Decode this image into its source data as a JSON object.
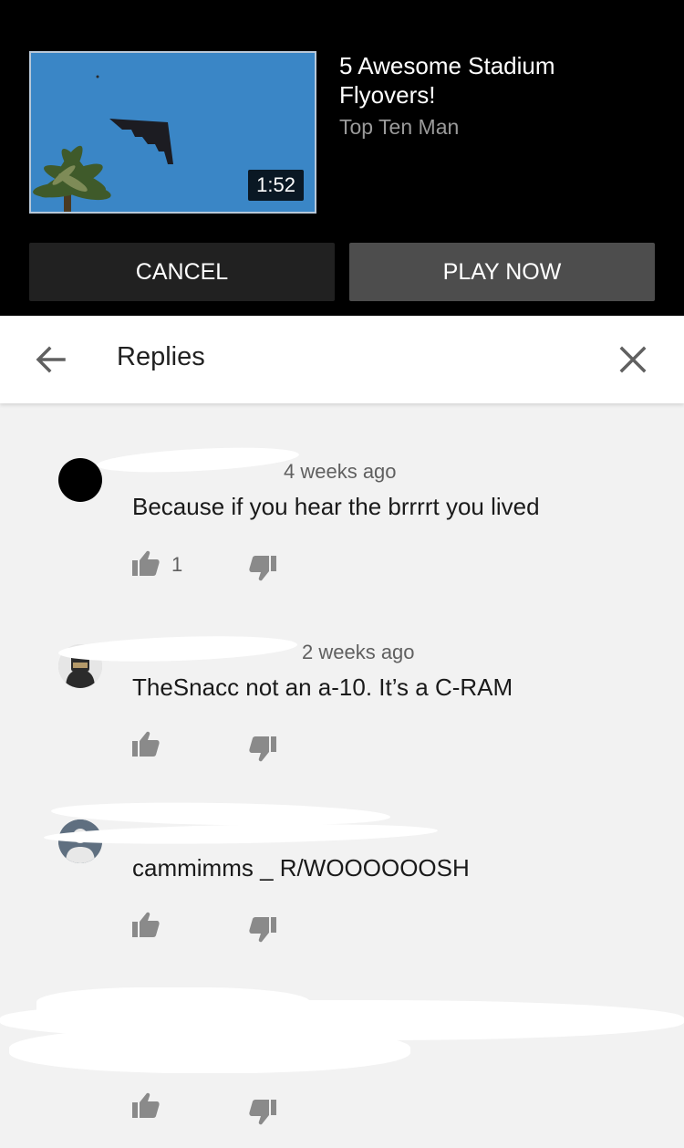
{
  "up_next": {
    "title": "5 Awesome Stadium Flyovers!",
    "channel": "Top Ten Man",
    "duration": "1:52",
    "cancel_label": "CANCEL",
    "play_label": "PLAY NOW"
  },
  "replies": {
    "title": "Replies"
  },
  "comments": [
    {
      "meta": "4 weeks ago",
      "text": "Because if you hear the brrrrt you lived",
      "likes": "1"
    },
    {
      "meta": "2 weeks ago",
      "text": "TheSnacc not an a-10. It’s a C-RAM",
      "likes": ""
    },
    {
      "meta": "",
      "text": "cammimms _ R/WOOOOOOSH",
      "likes": ""
    },
    {
      "meta": "",
      "text": "",
      "likes": ""
    }
  ],
  "colors": {
    "panel_bg": "#000000",
    "cancel_bg": "#212121",
    "play_bg": "#4d4d4d",
    "list_bg": "#f2f2f2",
    "icon_gray": "#8a8a8a"
  },
  "icons": {
    "back": "arrow-left-icon",
    "close": "close-icon",
    "like": "thumbs-up-icon",
    "dislike": "thumbs-down-icon"
  }
}
